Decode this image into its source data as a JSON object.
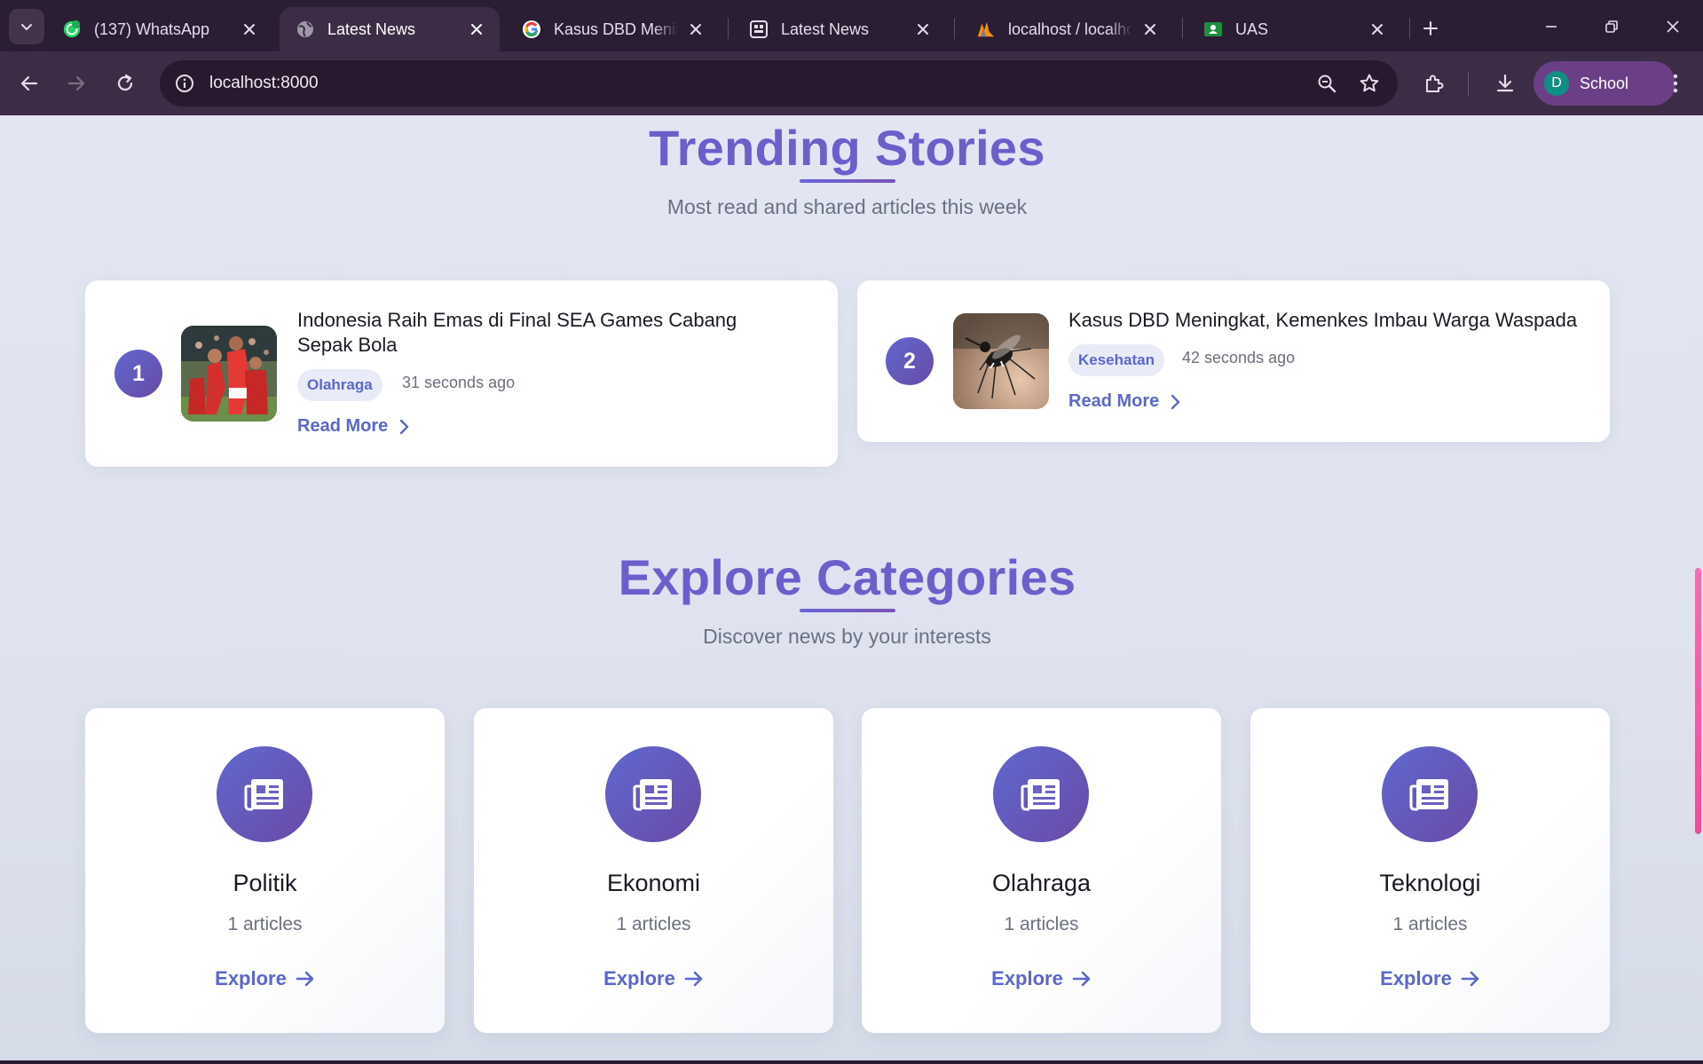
{
  "browser": {
    "tabs": [
      {
        "title": "(137) WhatsApp",
        "favicon": "whatsapp-icon",
        "active": false
      },
      {
        "title": "Latest News",
        "favicon": "globe-icon",
        "active": true
      },
      {
        "title": "Kasus DBD Meningkat",
        "favicon": "google-icon",
        "active": false
      },
      {
        "title": "Latest News",
        "favicon": "app-grid-icon",
        "active": false
      },
      {
        "title": "localhost / localhost",
        "favicon": "phpmyadmin-icon",
        "active": false
      },
      {
        "title": "UAS",
        "favicon": "classroom-icon",
        "active": false
      }
    ],
    "url": "localhost:8000",
    "profile_initial": "D",
    "profile_name": "School"
  },
  "trending": {
    "title": "Trending Stories",
    "subtitle": "Most read and shared articles this week",
    "items": [
      {
        "rank": "1",
        "headline": "Indonesia Raih Emas di Final SEA Games Cabang Sepak Bola",
        "category": "Olahraga",
        "time_ago": "31 seconds ago",
        "cta": "Read More"
      },
      {
        "rank": "2",
        "headline": "Kasus DBD Meningkat, Kemenkes Imbau Warga Waspada",
        "category": "Kesehatan",
        "time_ago": "42 seconds ago",
        "cta": "Read More"
      }
    ]
  },
  "categories": {
    "title": "Explore Categories",
    "subtitle": "Discover news by your interests",
    "items": [
      {
        "name": "Politik",
        "count": "1 articles",
        "cta": "Explore"
      },
      {
        "name": "Ekonomi",
        "count": "1 articles",
        "cta": "Explore"
      },
      {
        "name": "Olahraga",
        "count": "1 articles",
        "cta": "Explore"
      },
      {
        "name": "Teknologi",
        "count": "1 articles",
        "cta": "Explore"
      }
    ]
  },
  "colors": {
    "accent": "#5a67cc",
    "title_purple": "#6b5fcc",
    "browser_frame": "#2b1d33",
    "badge_bg": "#e9ebf8"
  }
}
